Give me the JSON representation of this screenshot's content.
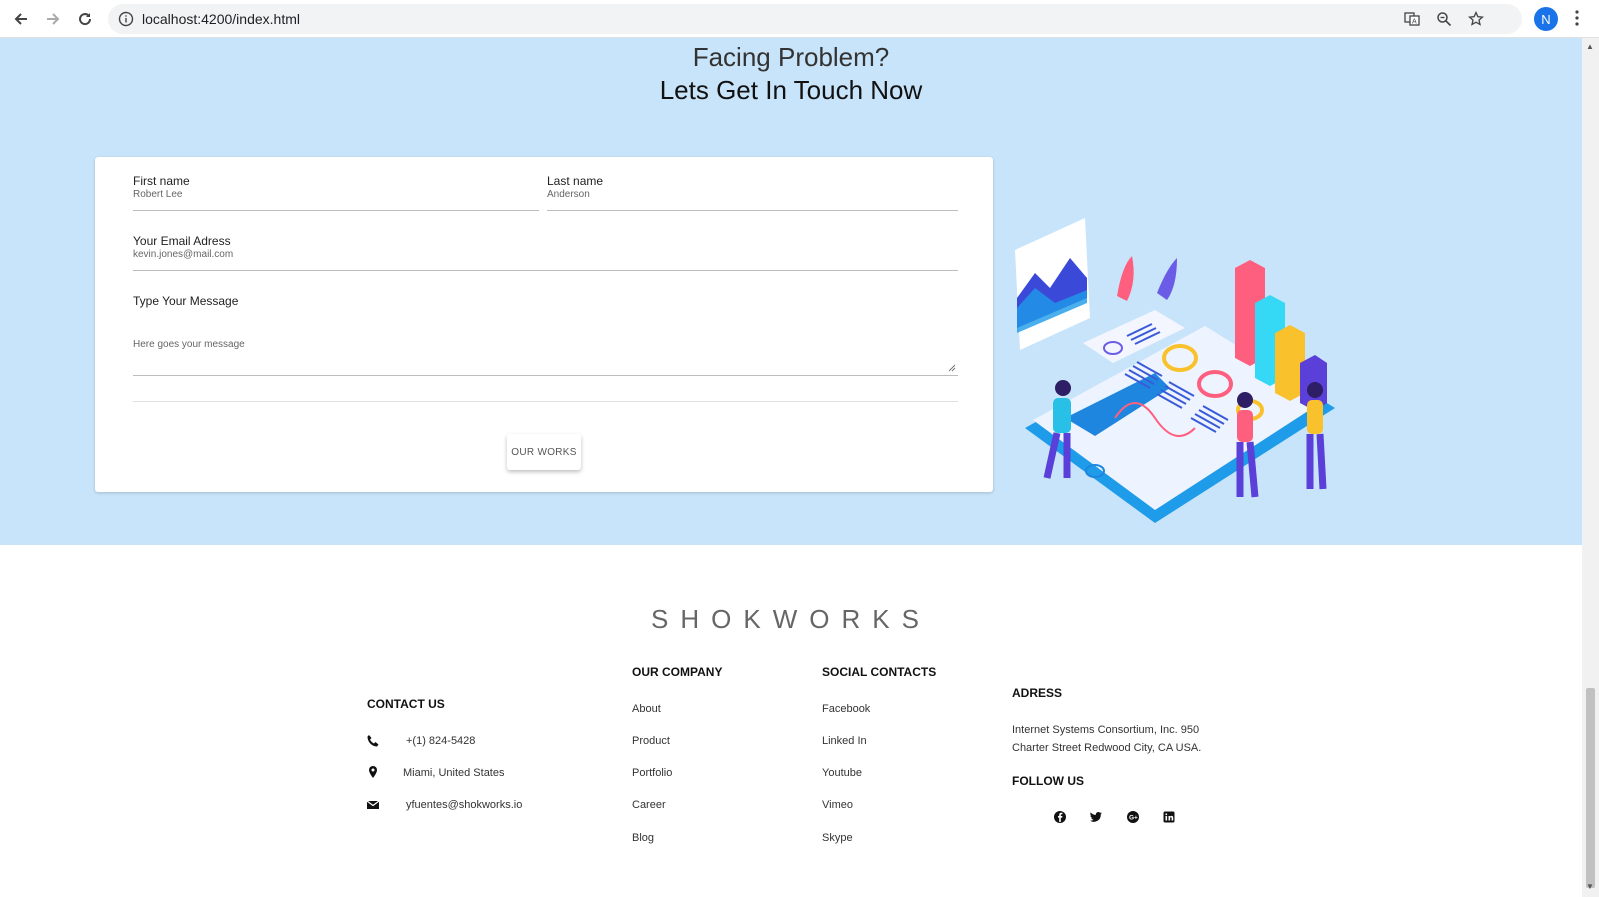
{
  "browser": {
    "url": "localhost:4200/index.html",
    "profile_initial": "N"
  },
  "contact": {
    "heading_line1": "Facing Problem?",
    "heading_line2": "Lets Get In Touch Now",
    "first_name": {
      "label": "First name",
      "value": "Robert Lee"
    },
    "last_name": {
      "label": "Last name",
      "value": "Anderson"
    },
    "email": {
      "label": "Your Email Adress",
      "value": "kevin.jones@mail.com"
    },
    "message": {
      "label": "Type Your Message",
      "value": "Here goes your message"
    },
    "button_label": "OUR WORKS"
  },
  "footer": {
    "logo": "SHOKWORKS",
    "contact_us": {
      "heading": "CONTACT US",
      "phone": "+(1) 824-5428",
      "location": "Miami, United States",
      "email": "yfuentes@shokworks.io"
    },
    "our_company": {
      "heading": "OUR COMPANY",
      "links": [
        "About",
        "Product",
        "Portfolio",
        "Career",
        "Blog"
      ]
    },
    "social_contacts": {
      "heading": "SOCIAL CONTACTS",
      "links": [
        "Facebook",
        "Linked In",
        "Youtube",
        "Vimeo",
        "Skype"
      ]
    },
    "adress": {
      "heading": "ADRESS",
      "line1": "Internet Systems Consortium, Inc. 950",
      "line2": "Charter Street Redwood City, CA USA."
    },
    "follow_us": {
      "heading": "FOLLOW US",
      "icons": [
        "facebook-icon",
        "twitter-icon",
        "google-plus-icon",
        "linkedin-icon"
      ]
    }
  },
  "colors": {
    "section_bg": "#c8e4fa",
    "accent_blue": "#1a73e8"
  }
}
